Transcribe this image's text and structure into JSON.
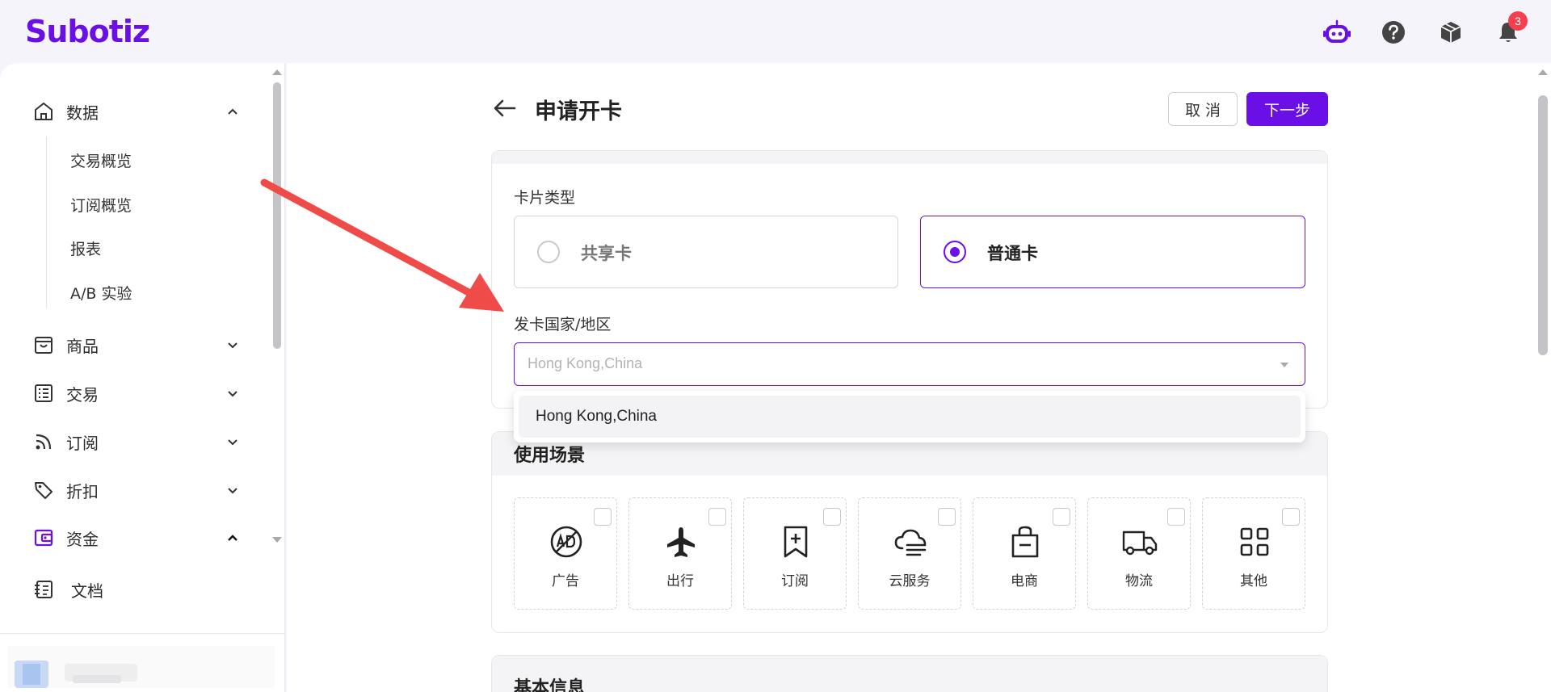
{
  "app": {
    "logo": "Subotiz"
  },
  "header": {
    "notification_count": "3",
    "icons": [
      "assistant-bot-icon",
      "help-icon",
      "box-icon",
      "bell-icon"
    ]
  },
  "sidebar": {
    "items": [
      {
        "label": "数据",
        "icon": "home-icon",
        "expanded": true
      },
      {
        "label": "商品",
        "icon": "store-icon",
        "expanded": false
      },
      {
        "label": "交易",
        "icon": "list-icon",
        "expanded": false
      },
      {
        "label": "订阅",
        "icon": "rss-icon",
        "expanded": false
      },
      {
        "label": "折扣",
        "icon": "tag-icon",
        "expanded": false
      },
      {
        "label": "资金",
        "icon": "wallet-icon",
        "expanded": true,
        "active": true
      },
      {
        "label": "文档",
        "icon": "document-icon"
      }
    ],
    "data_subitems": [
      "交易概览",
      "订阅概览",
      "报表",
      "A/B 实验"
    ]
  },
  "page": {
    "title": "申请开卡",
    "cancel_label": "取 消",
    "next_label": "下一步"
  },
  "card_type": {
    "label": "卡片类型",
    "options": [
      {
        "label": "共享卡",
        "selected": false
      },
      {
        "label": "普通卡",
        "selected": true
      }
    ]
  },
  "country": {
    "label": "发卡国家/地区",
    "placeholder": "Hong Kong,China",
    "dropdown_options": [
      "Hong Kong,China"
    ]
  },
  "usage": {
    "title": "使用场景",
    "scenes": [
      {
        "label": "广告",
        "icon": "ad-icon"
      },
      {
        "label": "出行",
        "icon": "airplane-icon"
      },
      {
        "label": "订阅",
        "icon": "bookmark-plus-icon"
      },
      {
        "label": "云服务",
        "icon": "cloud-icon"
      },
      {
        "label": "电商",
        "icon": "shopping-bag-icon"
      },
      {
        "label": "物流",
        "icon": "truck-icon"
      },
      {
        "label": "其他",
        "icon": "grid-icon"
      }
    ]
  },
  "basic_info": {
    "title": "基本信息"
  },
  "colors": {
    "brand": "#6a0fe6",
    "badge": "#f5404e",
    "annotation_arrow": "#ef4b48"
  }
}
